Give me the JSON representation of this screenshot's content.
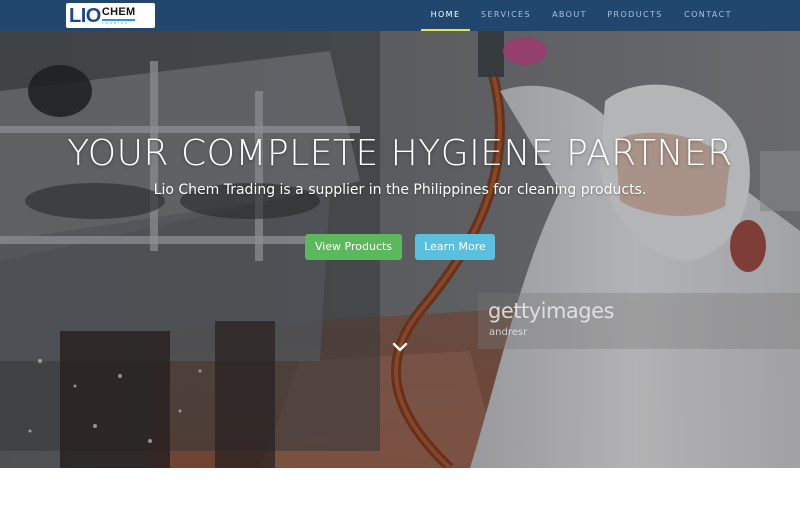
{
  "brand": {
    "logo_main": "LIO",
    "logo_second": "CHEM",
    "logo_tagline": "TRADING"
  },
  "nav": {
    "items": [
      {
        "label": "HOME",
        "active": true
      },
      {
        "label": "SERVICES",
        "active": false
      },
      {
        "label": "ABOUT",
        "active": false
      },
      {
        "label": "PRODUCTS",
        "active": false
      },
      {
        "label": "CONTACT",
        "active": false
      }
    ]
  },
  "hero": {
    "title": "YOUR COMPLETE HYGIENE PARTNER",
    "subtitle": "Lio Chem Trading is a supplier in the Philippines for cleaning products.",
    "primary_button": "View Products",
    "secondary_button": "Learn More",
    "scroll_icon": "chevron-down-icon"
  },
  "watermark": {
    "brand": "gettyimages",
    "author": "andresr"
  },
  "colors": {
    "navbar": "#21476f",
    "active_underline": "#f0e03c",
    "primary_button": "#5cb85c",
    "secondary_button": "#5bc0de"
  }
}
